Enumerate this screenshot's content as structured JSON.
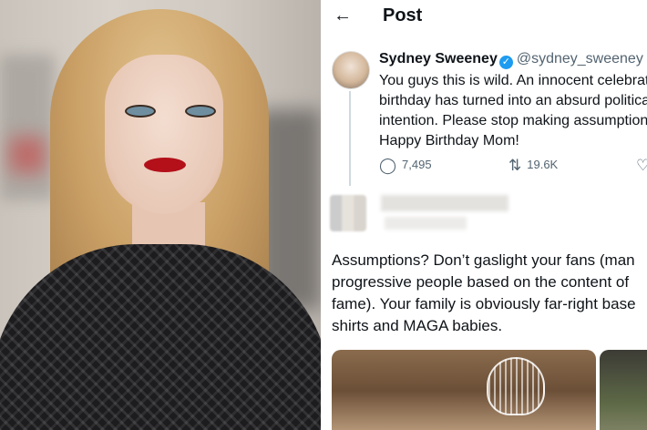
{
  "post_header": {
    "back_icon": "arrow-left-icon",
    "title": "Post"
  },
  "tweet": {
    "display_name": "Sydney Sweeney",
    "handle_line": "@sydney_sweeney · A",
    "body_lines": [
      "You guys this is wild. An innocent celebrati",
      "birthday has turned into an absurd politica",
      "intention. Please stop making assumptions",
      "Happy Birthday Mom!"
    ],
    "replies_count": "7,495",
    "reposts_count": "19.6K"
  },
  "reply": {
    "body_lines": [
      "Assumptions? Don’t gaslight your fans (man",
      "progressive people based on the content of",
      "fame). Your family is obviously far-right base",
      "shirts and MAGA babies."
    ]
  },
  "colors": {
    "verified_badge": "#1d9bf0",
    "text": "#0f1419",
    "muted": "#536471"
  }
}
